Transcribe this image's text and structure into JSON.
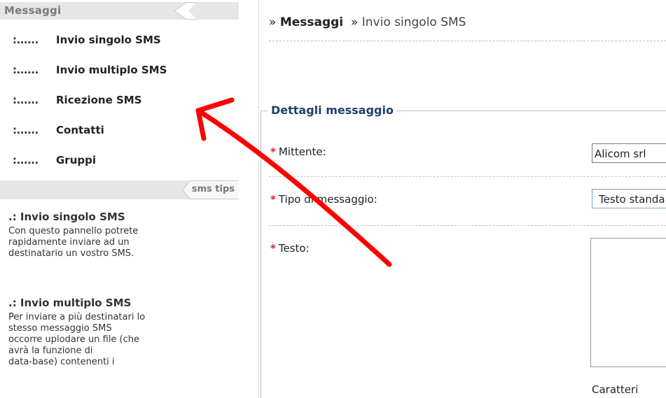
{
  "sidebar": {
    "header": "Messaggi",
    "menu_prefix": ":......",
    "items": [
      {
        "label": "Invio singolo SMS"
      },
      {
        "label": "Invio multiplo SMS"
      },
      {
        "label": "Ricezione SMS"
      },
      {
        "label": "Contatti"
      },
      {
        "label": "Gruppi"
      }
    ],
    "tips_header": "sms tips",
    "tips": [
      {
        "title": ".: Invio singolo SMS",
        "text": "Con questo pannello potrete\nrapidamente inviare ad un\ndestinatario un vostro SMS."
      },
      {
        "title": ".: Invio multiplo SMS",
        "text": "Per inviare a più destinatari lo\nstesso messaggio SMS\noccorre uplodare un file (che\navrà la funzione di\ndata-base) contenenti i"
      }
    ]
  },
  "breadcrumb": {
    "sep": "»",
    "level1": "Messaggi",
    "level2": "Invio singolo SMS"
  },
  "form": {
    "legend": "Dettagli messaggio",
    "required_mark": "*",
    "sender_label": "Mittente:",
    "sender_value": "Alicom srl",
    "type_label": "Tipo di messaggio:",
    "type_value": "Testo standard",
    "text_label": "Testo:",
    "chars_label": "Caratteri"
  },
  "colors": {
    "annotation_arrow": "#ff0000",
    "legend_text": "#1e3f6e",
    "required": "#e02020"
  }
}
